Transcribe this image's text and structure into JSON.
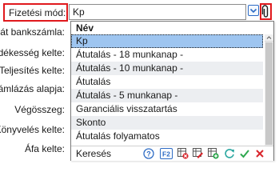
{
  "form": {
    "payment_label": "Fizetési mód:",
    "payment_value": "Kp",
    "left_labels": [
      "aját bankszámla:",
      "edékesség kelte:",
      "Teljesítés kelte:",
      "zámlázás alapja:",
      "Végösszeg:",
      "Könyvelés kelte:",
      "Áfa kelte:"
    ]
  },
  "dropdown": {
    "column_header": "Név",
    "options": [
      "Kp",
      "Átutalás - 18 munkanap -",
      "Átutalás - 10 munkanap -",
      "Átutalás",
      "Átutalás - 5 munkanap -",
      "Garanciális visszatartás",
      "Skonto",
      "Átutalás folyamatos"
    ],
    "selected_index": 0,
    "footer": {
      "search_label": "Keresés",
      "icons": [
        "help-icon",
        "f2-key-icon",
        "delete-grid-icon",
        "edit-grid-icon",
        "add-grid-icon",
        "refresh-icon",
        "confirm-icon",
        "cancel-icon"
      ]
    }
  },
  "colors": {
    "highlight_red": "#e0191d",
    "selected_row": "#9ec5f0",
    "alt_row": "#eceef1",
    "accent_blue": "#2d6bc4",
    "confirm_green": "#2fa84f",
    "cancel_red": "#d9262c"
  }
}
